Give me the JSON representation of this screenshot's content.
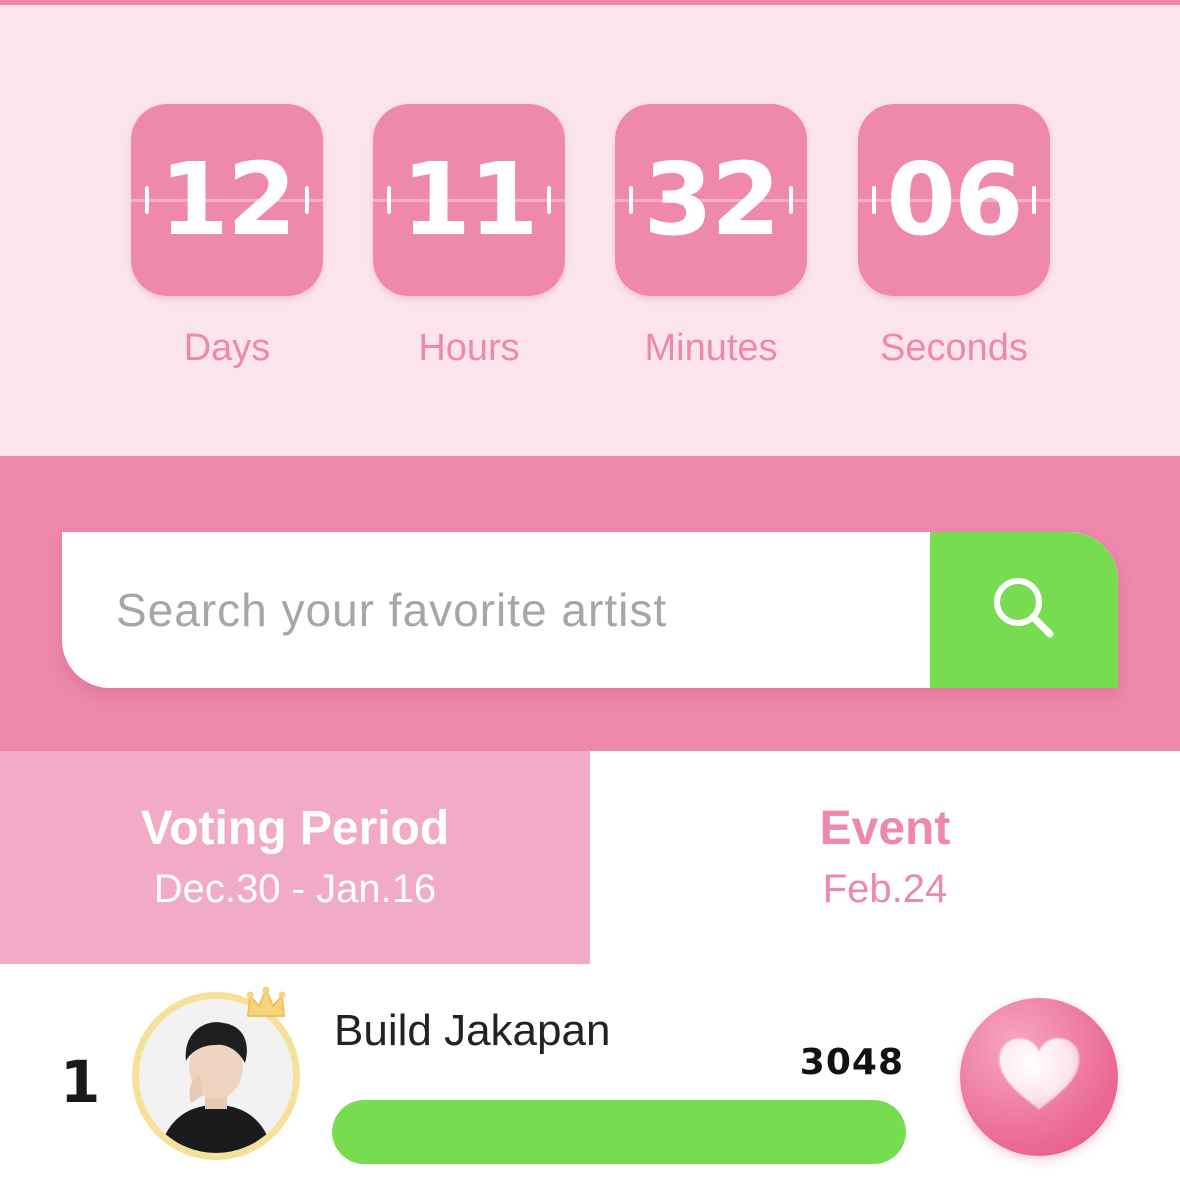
{
  "countdown": {
    "days": {
      "value": "12",
      "label": "Days"
    },
    "hours": {
      "value": "11",
      "label": "Hours"
    },
    "minutes": {
      "value": "32",
      "label": "Minutes"
    },
    "seconds": {
      "value": "06",
      "label": "Seconds"
    }
  },
  "search": {
    "placeholder": "Search your favorite artist",
    "value": ""
  },
  "tabs": [
    {
      "title": "Voting Period",
      "date": "Dec.30 - Jan.16",
      "selected": true
    },
    {
      "title": "Event",
      "date": "Feb.24",
      "selected": false
    }
  ],
  "ranking": [
    {
      "rank": "1",
      "name": "Build Jakapan",
      "votes": "3048",
      "progress": 1.0
    }
  ],
  "colors": {
    "pink": "#ee88ad",
    "pink_light": "#fbe4ee",
    "pink_tab": "#f1abc6",
    "green": "#77dc50",
    "crown": "#f6d57a"
  },
  "icons": {
    "search": "search-icon",
    "crown": "crown-icon",
    "vote": "heart-icon"
  }
}
